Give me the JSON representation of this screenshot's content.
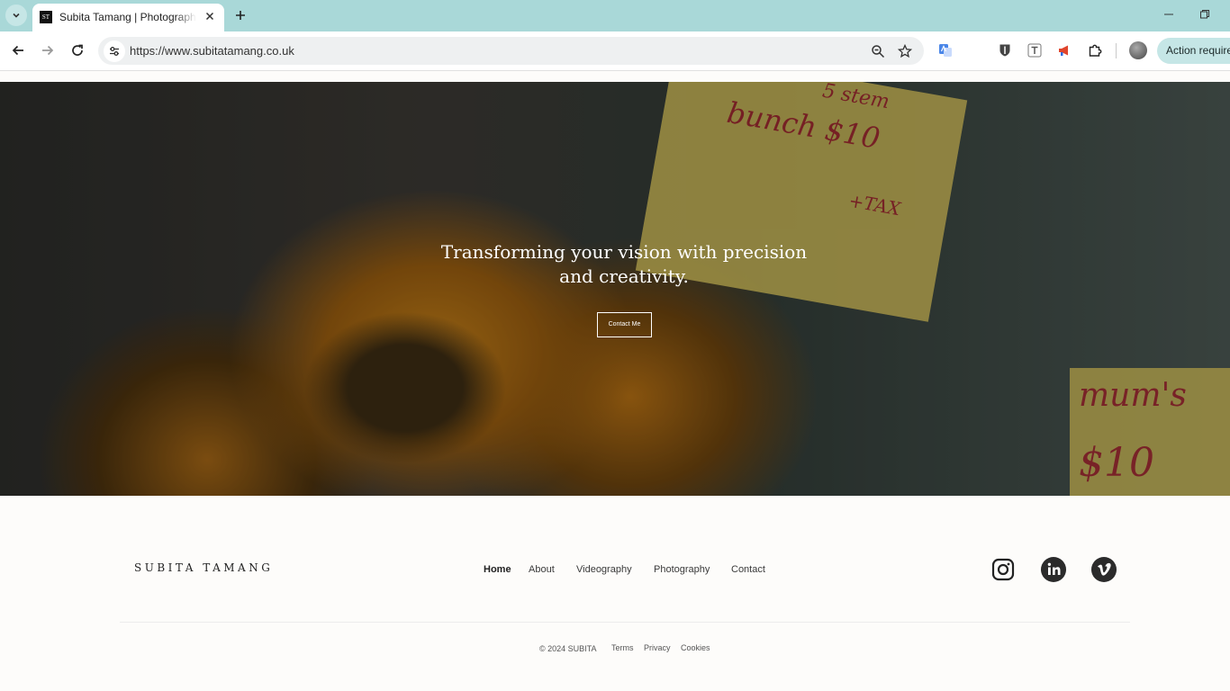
{
  "browser": {
    "tab": {
      "favicon_text": "ST",
      "title": "Subita Tamang | Photographer & Videographer"
    },
    "url": "https://www.subitatamang.co.uk",
    "action_button": "Action required"
  },
  "hero": {
    "headline": "Transforming your vision with precision and creativity.",
    "cta_label": "Contact Me",
    "sign_text_1": "bunch $10",
    "sign_text_2": "5 stem",
    "sign_text_3": "+TAX",
    "sign_text_4": "mum's",
    "sign_text_5": "$10"
  },
  "footer": {
    "logo": "SUBITA TAMANG",
    "nav": [
      {
        "label": "Home"
      },
      {
        "label": "About"
      },
      {
        "label": "Videography"
      },
      {
        "label": "Photography"
      },
      {
        "label": "Contact"
      }
    ],
    "social": [
      "instagram-icon",
      "linkedin-icon",
      "vimeo-icon"
    ],
    "copyright": "© 2024 SUBITA",
    "links": [
      {
        "label": "Terms"
      },
      {
        "label": "Privacy"
      },
      {
        "label": "Cookies"
      }
    ]
  },
  "colors": {
    "tabbar": "#a9d8d8",
    "action_button": "#c5e6e6",
    "footer_bg": "#fdfcfa",
    "sign_yellow": "#d9c45a",
    "sign_red": "#b3262e"
  }
}
